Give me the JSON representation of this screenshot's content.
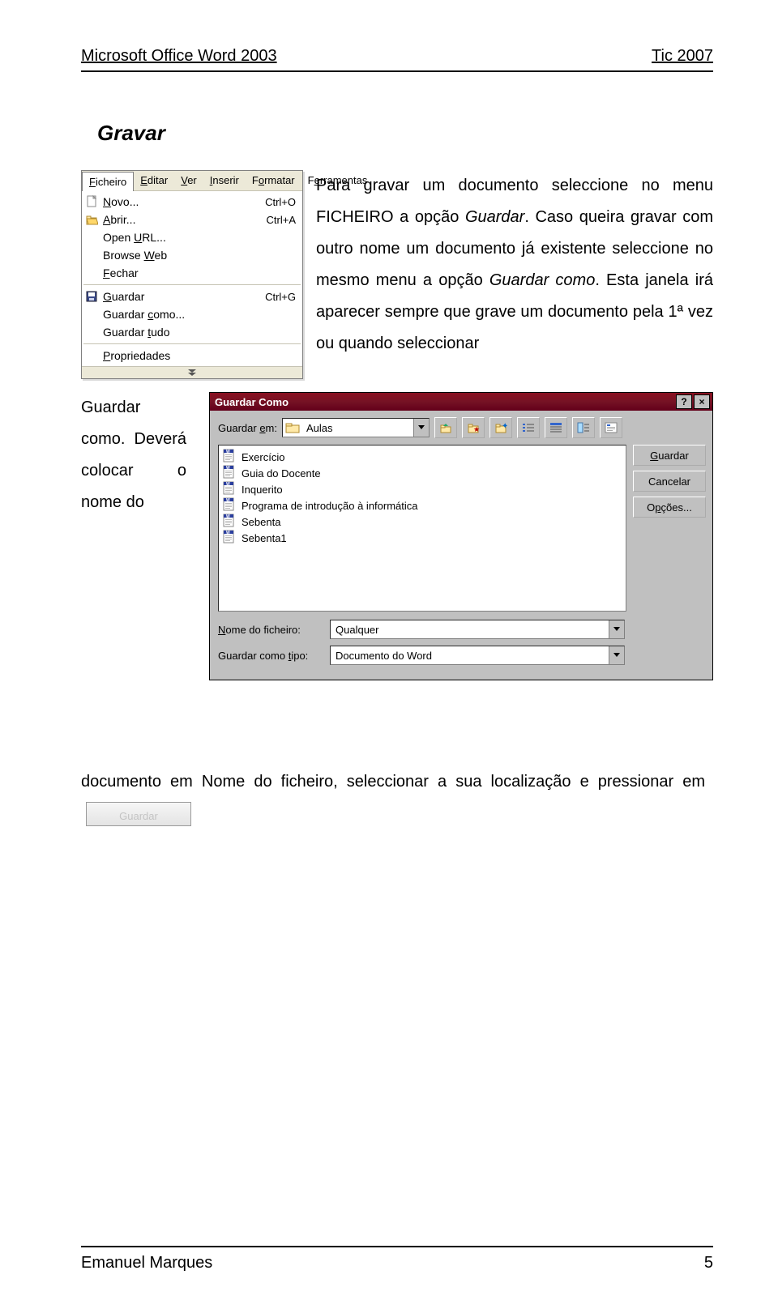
{
  "header": {
    "left": "Microsoft Office Word 2003",
    "right": "Tic 2007"
  },
  "section_title": "Gravar",
  "body": {
    "p1a": "Para gravar um documento seleccione no menu FICHEIRO a opção ",
    "p1_it1": "Guardar",
    "p1b": ". Caso queira gravar com outro nome um documento já existente seleccione no mesmo menu a opção ",
    "p1_it2": "Guardar como",
    "p1c": ". Esta janela irá aparecer sempre que grave um documento pela 1ª vez ou quando seleccionar ",
    "p1_it3": "Guardar como",
    "p1d": ". Deverá colocar o nome do",
    "p2a": "documento em ",
    "p2_it": "Nome do ficheiro",
    "p2b": ", seleccionar a sua localização e pressionar em",
    "press_btn_hint": "Guardar"
  },
  "menu": {
    "bar": [
      "Ficheiro",
      "Editar",
      "Ver",
      "Inserir",
      "Formatar",
      "Ferramentas"
    ],
    "bar_hot": [
      "F",
      "E",
      "V",
      "I",
      "o",
      "e"
    ],
    "items": [
      {
        "label": "Novo...",
        "hot": "N",
        "shortcut": "Ctrl+O",
        "icon": "new"
      },
      {
        "label": "Abrir...",
        "hot": "A",
        "shortcut": "Ctrl+A",
        "icon": "open"
      },
      {
        "label": "Open URL...",
        "hot": "U",
        "shortcut": "",
        "icon": ""
      },
      {
        "label": "Browse Web",
        "hot": "W",
        "shortcut": "",
        "icon": ""
      },
      {
        "label": "Fechar",
        "hot": "F",
        "shortcut": "",
        "icon": ""
      },
      {
        "sep": true
      },
      {
        "label": "Guardar",
        "hot": "G",
        "shortcut": "Ctrl+G",
        "icon": "save"
      },
      {
        "label": "Guardar como...",
        "hot": "c",
        "shortcut": "",
        "icon": ""
      },
      {
        "label": "Guardar tudo",
        "hot": "t",
        "shortcut": "",
        "icon": ""
      },
      {
        "sep": true
      },
      {
        "label": "Propriedades",
        "hot": "P",
        "shortcut": "",
        "icon": ""
      }
    ]
  },
  "dialog": {
    "title": "Guardar Como",
    "help": "?",
    "close": "×",
    "save_in_label": "Guardar em:",
    "save_in_value": "Aulas",
    "files": [
      "Exercício",
      "Guia do Docente",
      "Inquerito",
      "Programa de introdução à informática",
      "Sebenta",
      "Sebenta1"
    ],
    "filename_label": "Nome do ficheiro:",
    "filename_value": "Qualquer",
    "type_label": "Guardar como tipo:",
    "type_value": "Documento do Word",
    "btn_save": "Guardar",
    "btn_cancel": "Cancelar",
    "btn_options": "Opções..."
  },
  "footer": {
    "left": "Emanuel Marques",
    "right": "5"
  }
}
